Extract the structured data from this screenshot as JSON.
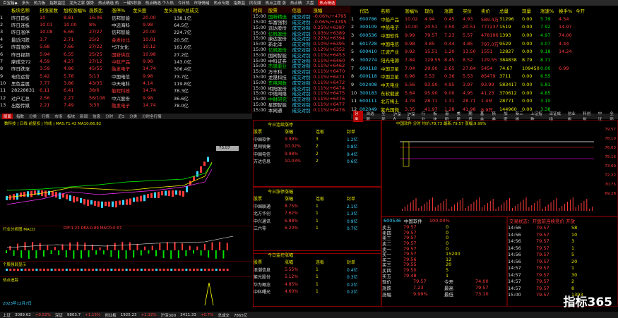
{
  "topbar": {
    "items": [
      "百宝箱◆",
      "多头",
      "热力板",
      "指数监控",
      "龙头之家 强势",
      "热点精选 热",
      "一键5秒游",
      "热点精选 个人热",
      "今日热",
      "市场情绪",
      "热点专题",
      "指数监",
      "同花顺",
      "热点主题 涨",
      "热点精",
      "大盘",
      "热点精选"
    ],
    "active": "热点精选"
  },
  "ladder": {
    "headers": [
      "板块名称",
      "封涨家数",
      "加权涨幅%",
      "涨跌比",
      "涨停%",
      "龙头股",
      "龙头涨幅%",
      "总成交"
    ],
    "rows": [
      [
        "1",
        "昨日首板",
        "10",
        "8.81",
        "16:06",
        "信邦智能",
        "z",
        "20.00",
        "138.1亿"
      ],
      [
        "2",
        "昨日连板",
        "10.01",
        "10.00",
        "8%",
        "中远海科",
        "z",
        "9.98",
        "64.5亿"
      ],
      [
        "3",
        "昨日涨停",
        "10.08",
        "6.66",
        "27/27",
        "信邦智能",
        "z",
        "20.00",
        "224.7亿"
      ],
      [
        "4",
        "最近闪跌",
        "3.7",
        "2.71",
        "25/2",
        "金发拉比",
        "r",
        "10.01",
        "20.5亿"
      ],
      [
        "5",
        "昨首涨停",
        "5.68",
        "7.66",
        "27/22",
        "*ST文化",
        "",
        "10.12",
        "161.6亿"
      ],
      [
        "6",
        "昨日视频",
        "5.94",
        "6.55",
        "25/25",
        "国新供应",
        "r",
        "10.98",
        "27.2亿"
      ],
      [
        "7",
        "摩成交72",
        "4.59",
        "4.27",
        "27/12",
        "中航产品",
        "r",
        "9.98",
        "143.0亿"
      ],
      [
        "8",
        "昨日跌涨",
        "3.59",
        "4.86",
        "45/55",
        "融发电子",
        "r",
        "14.74",
        "306.4亿"
      ],
      [
        "9",
        "电信运营",
        "5.42",
        "5.78",
        "5/13",
        "中国电信",
        "",
        "9.98",
        "73.7亿"
      ],
      [
        "10",
        "黑色金属",
        "7.77",
        "3.86",
        "43/35",
        "中天电科",
        "",
        "4.14",
        "119.8亿"
      ],
      [
        "11",
        "28228831",
        "6.11",
        "6.41",
        "38/6",
        "能程科技",
        "r",
        "14.74",
        "78.3亿"
      ],
      [
        "12",
        "过户汇总",
        "2.56",
        "2.27",
        "56/108",
        "中兴股份",
        "",
        "9.98",
        "36.6亿"
      ],
      [
        "13",
        "出版传媒",
        "2.21",
        "7.49",
        "3/35",
        "融发电子",
        "r",
        "14.74",
        "78.0亿"
      ]
    ]
  },
  "feed": {
    "title": "热点精选",
    "headers": [
      "时间",
      "股票",
      "信息",
      "涨幅"
    ],
    "rows": [
      [
        "15:00",
        "国新精选",
        "成交对别",
        "-0.06%/+4795"
      ],
      [
        "15:00",
        "华富强制",
        "成交对别",
        "-0.06%/+4795"
      ],
      [
        "15:00",
        "远达股份",
        "成交对别",
        "0.25%/+6387"
      ],
      [
        "15:00",
        "亿帆股份",
        "成交对别",
        "0.03%/+6389"
      ],
      [
        "15:00",
        "康达股份",
        "成交对别",
        "0.22%/+6394"
      ],
      [
        "15:00",
        "新北洋",
        "成交对别",
        "0.10%/+6395"
      ],
      [
        "15:00",
        "亿帆股份",
        "成交对别",
        "0.12%/+6352"
      ],
      [
        "15:00",
        "国网智能",
        "成交对别",
        "0.11%/+6453"
      ],
      [
        "15:00",
        "中科证券",
        "成交对别",
        "0.11%/+6460"
      ],
      [
        "15:00",
        "杰恩能业",
        "成交对别",
        "0.11%/+6462"
      ],
      [
        "15:00",
        "万丰科",
        "成交对别",
        "0.11%/+6470"
      ],
      [
        "15:00",
        "龙晟科技",
        "成交对别",
        "0.11%/+6471"
      ],
      [
        "15:00",
        "东电网数",
        "成交对别",
        "0.11%/+6472"
      ],
      [
        "15:00",
        "明阳股份",
        "成交对别",
        "0.11%/+6474"
      ],
      [
        "15:00",
        "中线网络",
        "成交对别",
        "0.11%/+6475"
      ],
      [
        "15:00",
        "中财研究",
        "成交对别",
        "0.11%/+6476"
      ],
      [
        "15:00",
        "星期智能",
        "成交对别",
        "0.11%/+6477"
      ],
      [
        "15:00",
        "本网通",
        "成交对别",
        "0.11%/+6478"
      ]
    ]
  },
  "stocks": {
    "headers": [
      "代码",
      "名称",
      "涨幅%",
      "现价",
      "涨跌",
      "买价",
      "卖价",
      "总量",
      "现量",
      "涨速%",
      "换手%",
      "今开"
    ],
    "rows": [
      [
        "1",
        "600786",
        "中船产品",
        "10.02",
        "4.94",
        "0.45",
        "4.93",
        "589.4万",
        "31296",
        "0.00",
        "5.79",
        "4.54"
      ],
      [
        "2",
        "300109",
        "中船电子",
        "10.00",
        "20.51",
        "3.50",
        "20.51",
        "777237",
        "1519",
        "0.00",
        "7.92",
        "14.97"
      ],
      [
        "3",
        "600536",
        "中国软件",
        "9.99",
        "79.57",
        "7.23",
        "5.57",
        "478196",
        "1393",
        "0.00",
        "4.97",
        "74.00"
      ],
      [
        "4",
        "601728",
        "中国电信",
        "9.98",
        "4.85",
        "0.44",
        "4.85",
        "797.0万",
        "9529",
        "0.00",
        "4.07",
        "4.44"
      ],
      [
        "5",
        "600410",
        "江波产业",
        "9.92",
        "15.51",
        "1.20",
        "13.50",
        "1551",
        "12827",
        "0.00",
        "9.18",
        "14.24"
      ],
      [
        "6",
        "300274",
        "阳光电源",
        "7.84",
        "129.55",
        "8.45",
        "8.52",
        "129.55",
        "384838",
        "8.79",
        "8.71"
      ],
      [
        "7",
        "600118",
        "中国卫星",
        "7.04",
        "29.90",
        "2.65",
        "27.84",
        "5454",
        "74.67",
        "109450",
        "0.00",
        "6.99"
      ],
      [
        "8",
        "600118",
        "中国卫星",
        "6.96",
        "5.53",
        "0.36",
        "5.53",
        "85479",
        "3711",
        "0.00",
        "6.55"
      ],
      [
        "9",
        "002408",
        "中天电业",
        "5.56",
        "93.90",
        "4.95",
        "3.97",
        "93.99",
        "583417",
        "0.00",
        "5.81"
      ],
      [
        "10",
        "300183",
        "东软载波",
        "5.64",
        "95.90",
        "9.00",
        "4.95",
        "41.23",
        "370612",
        "0.00",
        "4.85"
      ],
      [
        "11",
        "600111",
        "北方稀土",
        "4.78",
        "28.71",
        "1.31",
        "28.71",
        "1.4M",
        "28771",
        "0.00",
        "3.10"
      ],
      [
        "12",
        "002049",
        "紫光国微",
        "3.35",
        "41.97",
        "1.28",
        "41.98",
        "8.9万",
        "144960",
        "0.00",
        "3.38"
      ],
      [
        "13",
        "002028",
        "思源电器",
        "2.78",
        "76.29",
        "2.42",
        "8.19",
        "78.29",
        "3/0413",
        "0.00",
        "3.67"
      ],
      [
        "14",
        "600765",
        "中航重机",
        "2.16",
        "33.51",
        "0.75",
        "33.49",
        "33.51",
        "187962",
        "0.00",
        "2.98"
      ],
      [
        "15",
        "601099",
        "太平洋",
        "2.95",
        "21.91",
        "0.33",
        "21.91",
        "1.1M",
        "127.1万",
        "0.00",
        "1.26"
      ]
    ]
  },
  "left_tabs": [
    "版面",
    "指数",
    "分类",
    "行情",
    "市场",
    "板块",
    "新闻",
    "信息",
    "分时",
    "近3",
    "分类",
    "分时全行情"
  ],
  "mid_tabs": [
    "分类",
    "自选股",
    "全部",
    "沪深A",
    "沪深B",
    "行业",
    "板块",
    "港股",
    "美股",
    "期货",
    "基金",
    "债券",
    "加密",
    "新三板",
    "上证指数",
    "深证成指",
    "创业板",
    "科创板",
    "中证",
    "全部"
  ],
  "kline": {
    "title": "数科技 | 日线 前复权 | 均线 | MA5:71.42 MA10:66.82",
    "price_tag": "73.07",
    "vol_title": "行业分析图 MACD",
    "vol_info": "DIF:1.23 DEA:0.89 MACD:0.67",
    "rsi_title": "个股强弱显示",
    "hot_title": "热点追踪",
    "bottom_date": "2023年12月7日"
  },
  "cross": [
    {
      "title": "今日连续涨停",
      "cols": [
        "股票",
        "涨幅",
        "连板",
        "封单"
      ],
      "rows": [
        [
          "中国软件",
          "9.99%",
          "3",
          "1.2亿"
        ],
        [
          "星网锐捷",
          "10.02%",
          "2",
          "0.8亿"
        ],
        [
          "中国电信",
          "9.98%",
          "2",
          "9.4亿"
        ],
        [
          "万达信息",
          "10.03%",
          "2",
          "0.6亿"
        ]
      ]
    },
    {
      "title": "今日涨停涨幅",
      "cols": [
        "股票",
        "涨幅",
        "连板",
        "封单"
      ],
      "rows": [
        [
          "中国联通",
          "8.75%",
          "1",
          "2.1亿"
        ],
        [
          "北方华创",
          "7.62%",
          "1",
          "1.3亿"
        ],
        [
          "中兴通讯",
          "6.88%",
          "1",
          "0.9亿"
        ],
        [
          "三六零",
          "6.20%",
          "1",
          "0.7亿"
        ]
      ]
    },
    {
      "title": "今日监控涨幅",
      "cols": [
        "股票",
        "涨幅",
        "连板",
        "封单"
      ],
      "rows": [
        [
          "浪潮信息",
          "5.55%",
          "1",
          "0.4亿"
        ],
        [
          "紫光股份",
          "5.12%",
          "1",
          "0.3亿"
        ],
        [
          "华为概念",
          "4.85%",
          "1",
          "0.2亿"
        ],
        [
          "中科曙光",
          "4.60%",
          "1",
          "0.2亿"
        ]
      ]
    }
  ],
  "intraday": {
    "title": "中国软件  分时  均价:78.73  最新:79.57  涨幅:9.99%",
    "levels": [
      "79.57",
      "78.10",
      "76.63",
      "75.16",
      "73.69",
      "72.22",
      "70.75",
      "69.28"
    ]
  },
  "quote": {
    "code": "600536",
    "name": "中国软件",
    "pct": "100.00%",
    "sell_levels": [
      [
        "卖五",
        "79.57",
        "0"
      ],
      [
        "卖四",
        "79.57",
        "0"
      ],
      [
        "卖三",
        "79.57",
        "0"
      ],
      [
        "卖二",
        "79.57",
        "0"
      ],
      [
        "卖一",
        "79.57",
        "0"
      ]
    ],
    "buy_levels": [
      [
        "买一",
        "79.57",
        "15200"
      ],
      [
        "买二",
        "79.56",
        "12"
      ],
      [
        "买三",
        "79.55",
        "20"
      ],
      [
        "买四",
        "79.50",
        "5"
      ],
      [
        "买五",
        "79.48",
        "1"
      ]
    ],
    "stats": [
      [
        "现价",
        "79.57",
        "今开",
        "74.00"
      ],
      [
        "涨跌",
        "7.23",
        "最高",
        "79.57"
      ],
      [
        "涨幅",
        "9.99%",
        "最低",
        "73.10"
      ]
    ]
  },
  "trades": {
    "title": "交易状态：开盘前连续竞价 开放",
    "rows": [
      [
        "14:56",
        "79.57",
        "58"
      ],
      [
        "14:56",
        "79.57",
        "10"
      ],
      [
        "14:56",
        "79.57",
        "3"
      ],
      [
        "14:56",
        "79.57",
        "1"
      ],
      [
        "14:56",
        "79.57",
        "5"
      ],
      [
        "14:56",
        "79.57",
        "20"
      ],
      [
        "14:57",
        "79.57",
        "1"
      ],
      [
        "14:57",
        "79.57",
        "30"
      ],
      [
        "14:57",
        "79.57",
        "2"
      ],
      [
        "14:57",
        "79.57",
        "8"
      ],
      [
        "15:00",
        "79.57",
        "1393"
      ]
    ]
  },
  "logo": "指标365",
  "status": {
    "items": [
      "上证",
      "3089.62",
      "+0.52%",
      "深证",
      "9803.7",
      "+1.15%",
      "创业板",
      "1925.23",
      "+1.32%",
      "沪深300",
      "3411.33",
      "+0.7%",
      "总成交",
      "7865亿"
    ]
  }
}
